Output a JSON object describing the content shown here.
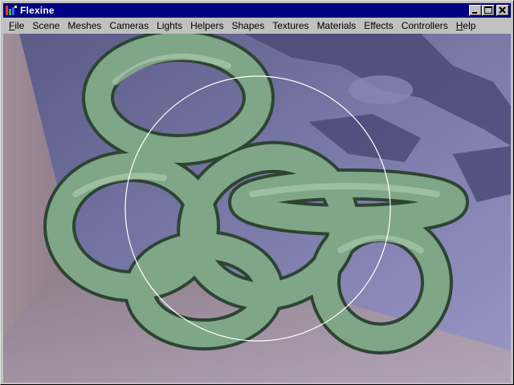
{
  "window": {
    "title": "Flexine",
    "icon": "flexine-app-icon",
    "controls": {
      "minimize": "minimize-icon",
      "maximize": "maximize-icon",
      "close": "close-icon"
    }
  },
  "menu": {
    "items": [
      {
        "label": "File",
        "mnemonic": "F",
        "rest": "ile"
      },
      {
        "label": "Scene",
        "mnemonic": "",
        "rest": "Scene"
      },
      {
        "label": "Meshes",
        "mnemonic": "",
        "rest": "Meshes"
      },
      {
        "label": "Cameras",
        "mnemonic": "",
        "rest": "Cameras"
      },
      {
        "label": "Lights",
        "mnemonic": "",
        "rest": "Lights"
      },
      {
        "label": "Helpers",
        "mnemonic": "",
        "rest": "Helpers"
      },
      {
        "label": "Shapes",
        "mnemonic": "",
        "rest": "Shapes"
      },
      {
        "label": "Textures",
        "mnemonic": "",
        "rest": "Textures"
      },
      {
        "label": "Materials",
        "mnemonic": "",
        "rest": "Materials"
      },
      {
        "label": "Effects",
        "mnemonic": "",
        "rest": "Effects"
      },
      {
        "label": "Controllers",
        "mnemonic": "",
        "rest": "Controllers"
      },
      {
        "label": "Help",
        "mnemonic": "H",
        "rest": "elp"
      }
    ]
  },
  "scene": {
    "object": "green torus knot",
    "colors": {
      "torus": "#7fa686",
      "torus_dark": "#2f4a35",
      "back_wall": "#8a89b8",
      "floor": "#a69aae",
      "left_wall": "#998892",
      "shadow": "#4e4c78",
      "selection_ring": "#ffffff"
    }
  }
}
